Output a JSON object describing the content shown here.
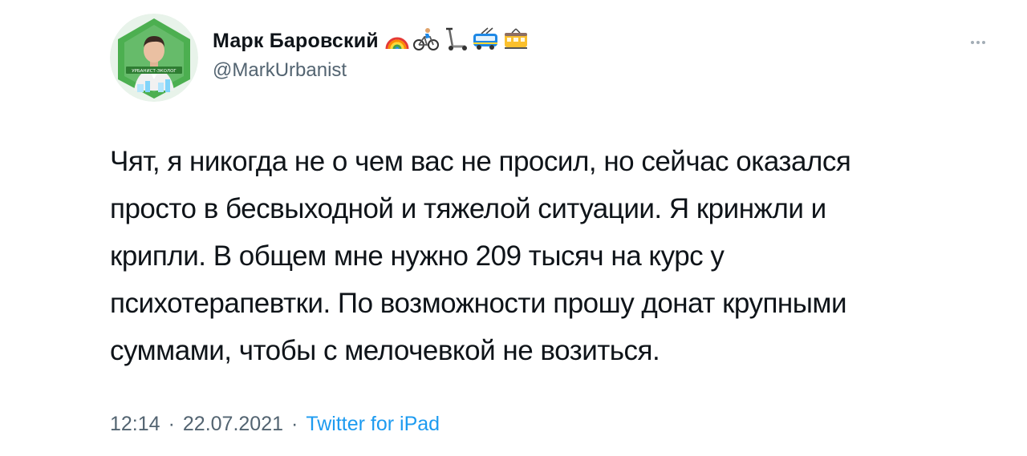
{
  "author": {
    "display_name": "Марк Баровский",
    "handle": "@MarkUrbanist",
    "name_emojis": [
      "rainbow-emoji",
      "cyclist-emoji",
      "kick-scooter-emoji",
      "trolleybus-emoji",
      "tram-emoji"
    ],
    "avatar": {
      "badge_text": "УРБАНИСТ-ЭКОЛОГ",
      "accent_color": "#4caf50"
    }
  },
  "tweet": {
    "text": "Чят, я никогда не о чем вас не просил, но сейчас оказался\nпросто в бесвыходной и тяжелой ситуации. Я кринжли и\nкрипли. В общем мне нужно 209 тысяч на курс у\nпсихотерапевтки. По возможности прошу донат крупными\nсуммами, чтобы с мелочевкой не возиться."
  },
  "meta": {
    "time": "12:14",
    "separator": "·",
    "date": "22.07.2021",
    "source": "Twitter for iPad"
  },
  "colors": {
    "text": "#0f1419",
    "secondary": "#536471",
    "link": "#1d9bf0"
  },
  "icons": {
    "more": "more-dots-icon"
  }
}
